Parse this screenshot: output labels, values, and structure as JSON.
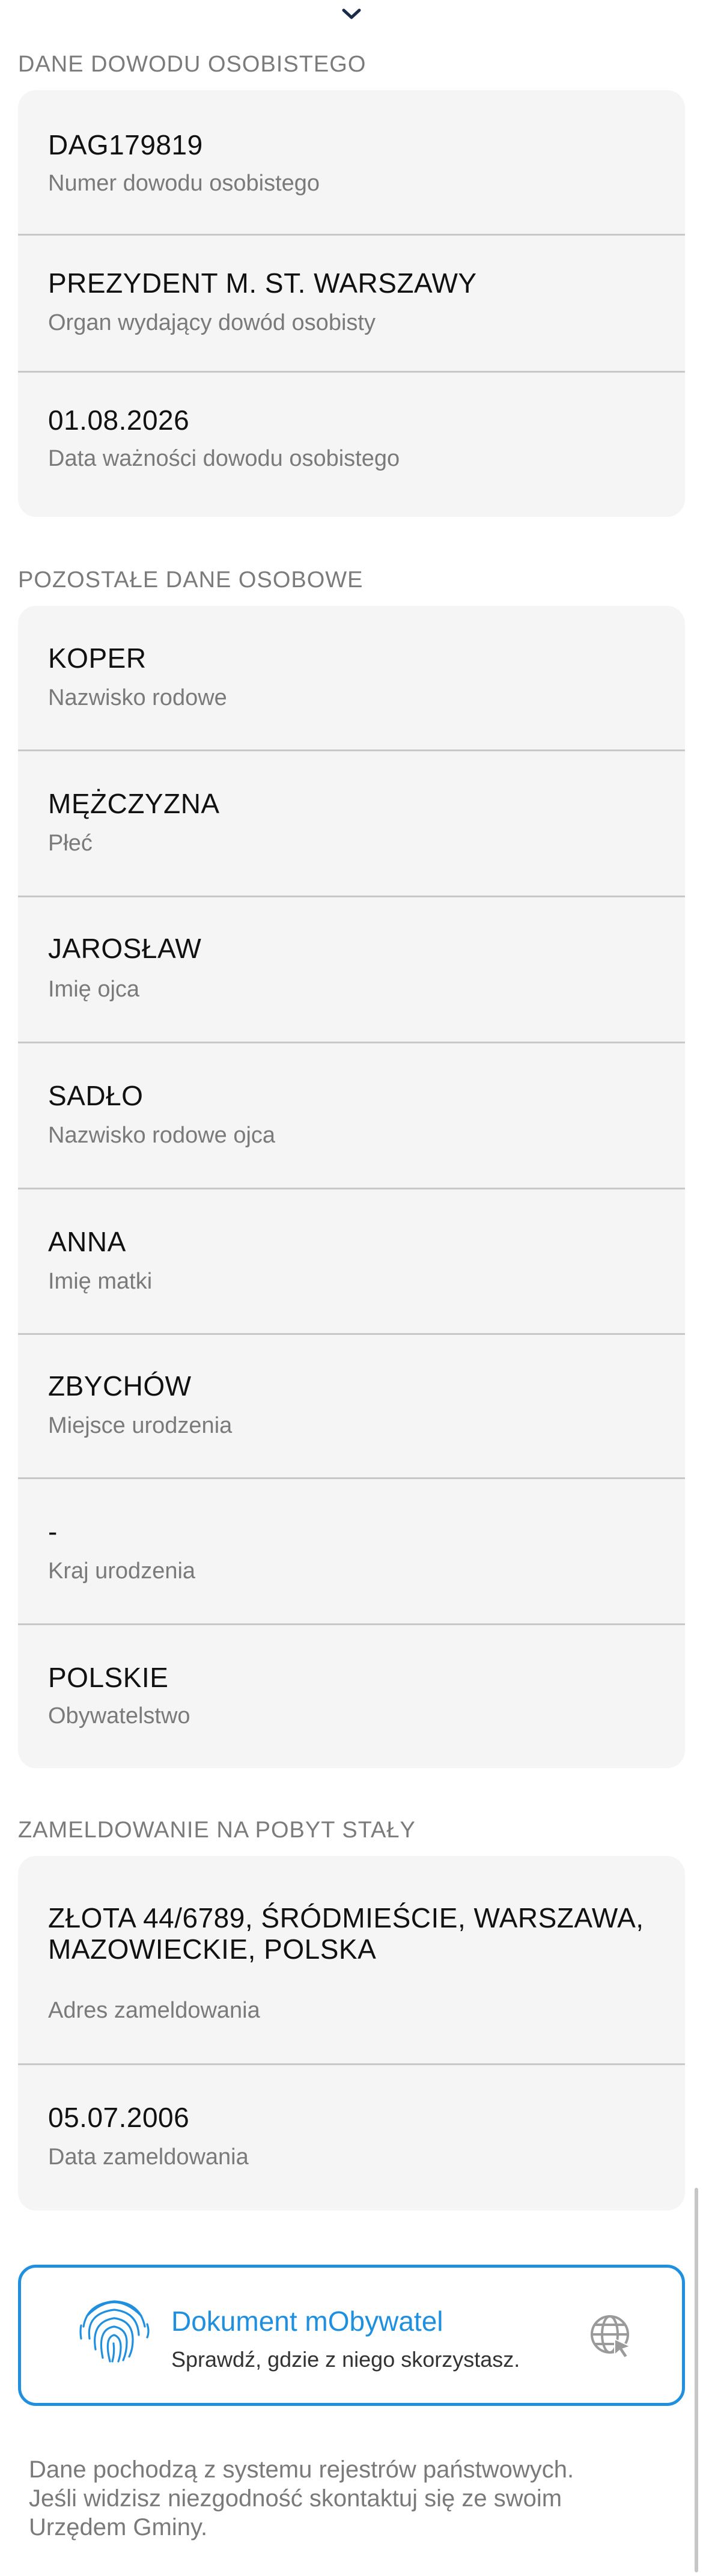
{
  "sections": {
    "id_card": {
      "header": "DANE DOWODU OSOBISTEGO",
      "rows": [
        {
          "value": "DAG179819",
          "label": "Numer dowodu osobistego"
        },
        {
          "value": "PREZYDENT M. ST. WARSZAWY",
          "label": "Organ wydający dowód osobisty"
        },
        {
          "value": "01.08.2026",
          "label": "Data ważności dowodu osobistego"
        }
      ]
    },
    "other": {
      "header": "POZOSTAŁE DANE OSOBOWE",
      "rows": [
        {
          "value": "KOPER",
          "label": "Nazwisko rodowe"
        },
        {
          "value": "MĘŻCZYZNA",
          "label": "Płeć"
        },
        {
          "value": "JAROSŁAW",
          "label": "Imię ojca"
        },
        {
          "value": "SADŁO",
          "label": "Nazwisko rodowe ojca"
        },
        {
          "value": "ANNA",
          "label": "Imię matki"
        },
        {
          "value": "ZBYCHÓW",
          "label": "Miejsce urodzenia"
        },
        {
          "value": "-",
          "label": "Kraj urodzenia"
        },
        {
          "value": "POLSKIE",
          "label": "Obywatelstwo"
        }
      ]
    },
    "residence": {
      "header": "ZAMELDOWANIE NA POBYT STAŁY",
      "rows": [
        {
          "value_line1": "ZŁOTA 44/6789, ŚRÓDMIEŚCIE, WARSZAWA,",
          "value_line2": "MAZOWIECKIE, POLSKA",
          "label": "Adres zameldowania"
        },
        {
          "value": "05.07.2006",
          "label": "Data zameldowania"
        }
      ]
    }
  },
  "promo": {
    "title": "Dokument mObywatel",
    "subtitle": "Sprawdź, gdzie z niego skorzystasz.",
    "accent": "#1f8fe0"
  },
  "footer": {
    "line1": "Dane pochodzą z systemu rejestrów państwowych.",
    "line2": "Jeśli widzisz niezgodność skontaktuj się ze swoim",
    "line3": "Urzędem Gminy."
  },
  "icons": {
    "top": "chevron-down-icon",
    "promo_left": "fingerprint-icon",
    "promo_right": "globe-icon"
  }
}
